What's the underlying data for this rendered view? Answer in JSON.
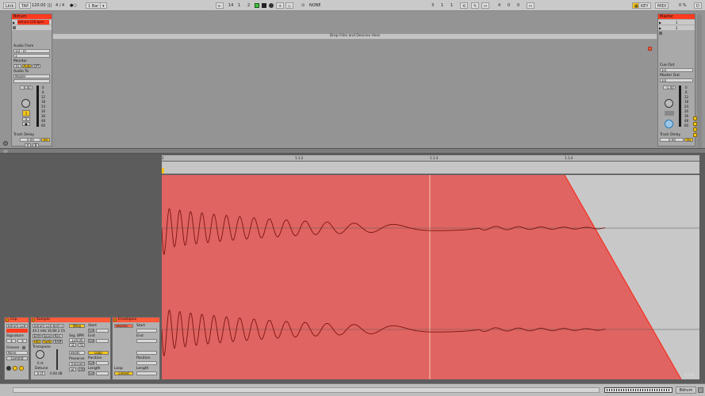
{
  "transport": {
    "link": "Link",
    "tap": "TAP",
    "tempo": "120.00",
    "signature_num": "4",
    "signature_den": "4",
    "quantize": "1 Bar",
    "pos_bar": "14",
    "pos_beat": "1",
    "pos_sixteenth": "2",
    "midi_label": "NONE",
    "loop_start_bar": "3",
    "loop_start_beat": "1",
    "loop_start_sixteenth": "1",
    "loop_len_bar": "4",
    "loop_len_beat": "0",
    "loop_len_sixteenth": "0",
    "key": "KEY",
    "midi": "MIDI",
    "cpu": "0 %",
    "disk_d": "D"
  },
  "track": {
    "name": "Bdrum",
    "clip_name": "bdrum-120-bpm",
    "audio_from_label": "Audio From",
    "audio_from_value": "1/2 ·  In",
    "audio_from_channel": "1",
    "monitor_label": "Monitor",
    "monitor_options": [
      "In",
      "Auto",
      "Off"
    ],
    "audio_to_label": "Audio To",
    "audio_to_value": "Master",
    "volume": "-0.00",
    "meter_ticks": [
      "0",
      "6",
      "12",
      "18",
      "24",
      "30",
      "36",
      "48",
      "60"
    ],
    "track_number": "1",
    "solo": "S",
    "arm": "●",
    "track_delay_label": "Track Delay",
    "track_delay_value": "0.00",
    "track_delay_unit": "ms",
    "bottom_buttons": [
      "A",
      "B"
    ]
  },
  "master": {
    "name": "Master",
    "scenes": [
      "1",
      "2"
    ],
    "cue_out_label": "Cue Out",
    "cue_out_value": "1/2",
    "master_out_label": "Master Out",
    "master_out_value": "1/2",
    "volume": "-1.00",
    "meter_ticks": [
      "0",
      "6",
      "12",
      "18",
      "24",
      "30",
      "36",
      "48",
      "60"
    ],
    "track_delay_label": "Track Delay",
    "track_delay_value": "0.00",
    "track_delay_unit": "ms"
  },
  "session": {
    "drop_text": "Drop Files and Devices Here"
  },
  "timeline": {
    "markers": [
      "1",
      "1.1.2",
      "1.1.3",
      "1.1.4"
    ],
    "zoom_label": "1/16"
  },
  "clip_panel": {
    "title": "Clip",
    "name": "bdrum-120-b",
    "signature_label": "Signature",
    "sig_num": "4",
    "sig_den": "4",
    "groove_label": "Groove",
    "groove_value": "None",
    "commit": "Commit"
  },
  "sample_panel": {
    "title": "Sample",
    "file": "bdrum-120-bpm-1.wi",
    "info": "44.1 kHz 16 Bit 2 Ch",
    "edit": "Edit",
    "save": "Save",
    "rev": "Rev.",
    "hiq": "HiQ",
    "fade": "Fade",
    "ram": "RAM",
    "transpose_label": "Transpose",
    "transpose_value": "0 st",
    "detune_label": "Detune",
    "detune_value": "0 ct",
    "gain_value": "0.00 dB",
    "warp": "Warp",
    "seg_bpm_label": "Seg. BPM",
    "seg_bpm_value": "120.00",
    "half": ":2",
    "double": "*2",
    "mode": "Beats",
    "preserve_label": "Preserve",
    "preserve_value": "Transients",
    "start_label": "Start",
    "end_label": "End",
    "loop": "Loop",
    "position_label": "Position",
    "length_label": "Length",
    "set": "Set"
  },
  "env_panel": {
    "title": "Envelopes",
    "device": "Volume",
    "start_label": "Start",
    "end_label": "End",
    "loop_label": "Loop",
    "linked": "Linked",
    "position_label": "Position",
    "length_label": "Length"
  },
  "bottom": {
    "track_tab": "Bdrum"
  },
  "colors": {
    "accent": "#ff3a1f",
    "waveform_bg": "#e06461",
    "waveform_line": "#7a1512",
    "highlight": "#f5c518"
  }
}
